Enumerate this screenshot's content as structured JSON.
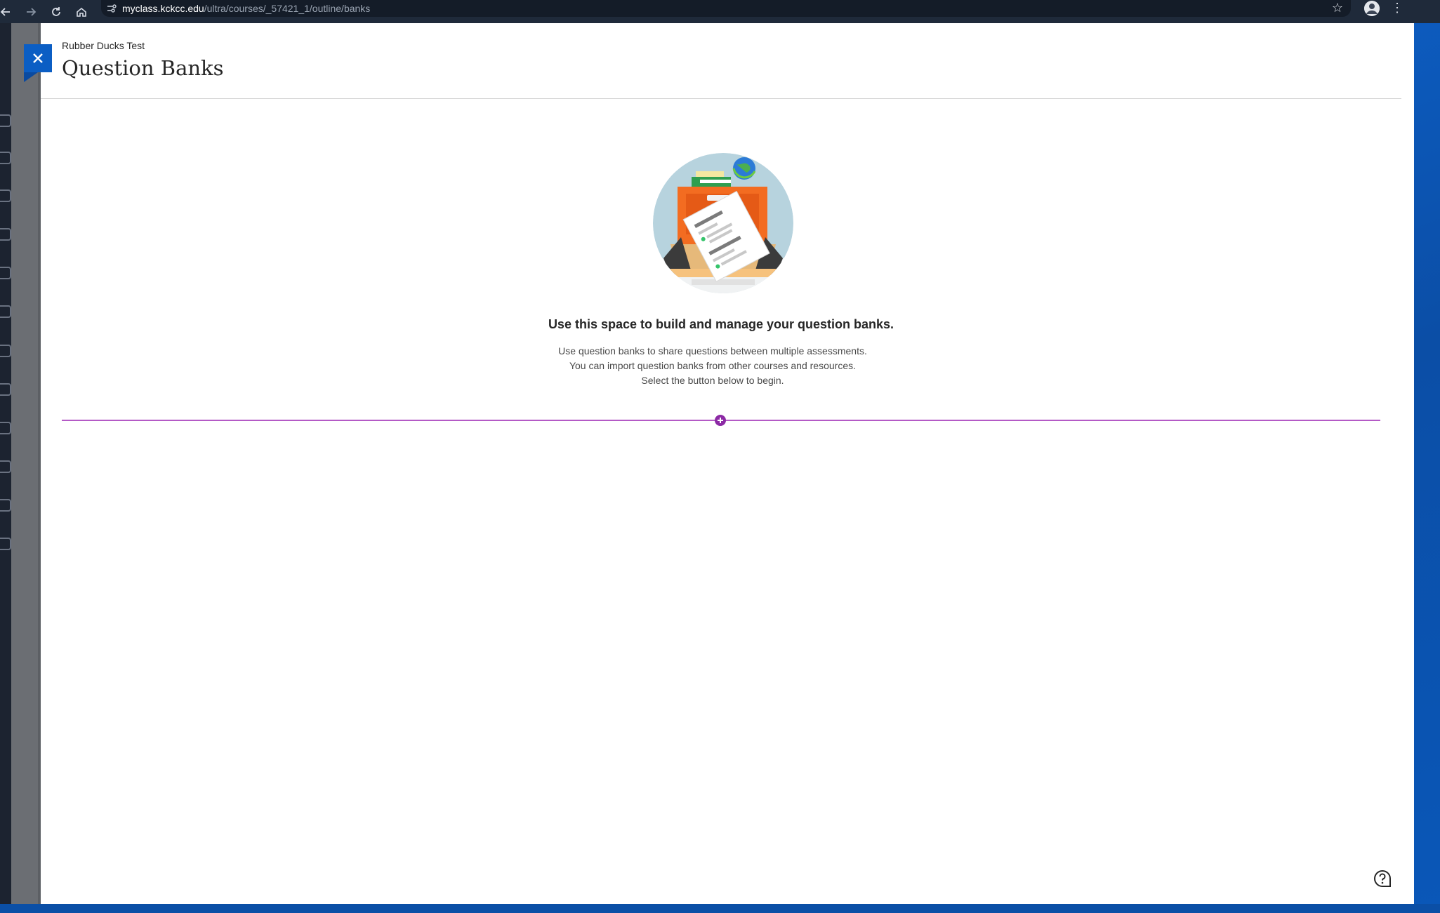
{
  "browser": {
    "url_host": "myclass.kckcc.edu",
    "url_path": "/ultra/courses/_57421_1/outline/banks",
    "icons": [
      "back-arrow-icon",
      "forward-arrow-icon",
      "reload-icon",
      "home-icon",
      "site-info-icon",
      "bookmark-star-icon",
      "profile-icon",
      "browser-menu-icon"
    ]
  },
  "panel": {
    "course_name": "Rubber Ducks Test",
    "title": "Question Banks",
    "close_icon": "close-icon"
  },
  "empty_state": {
    "heading": "Use this space to build and manage your question banks.",
    "lines": [
      "Use question banks to share questions between multiple assessments.",
      "You can import question banks from other courses and resources.",
      "Select the button below to begin."
    ],
    "add_icon": "plus-circle-icon"
  },
  "help": {
    "icon": "help-icon"
  },
  "colors": {
    "accent_purple": "#8c2aa5",
    "divider_purple": "#b45ac6",
    "close_blue": "#0b5ec4",
    "chrome_dark": "#1f2a3a"
  }
}
